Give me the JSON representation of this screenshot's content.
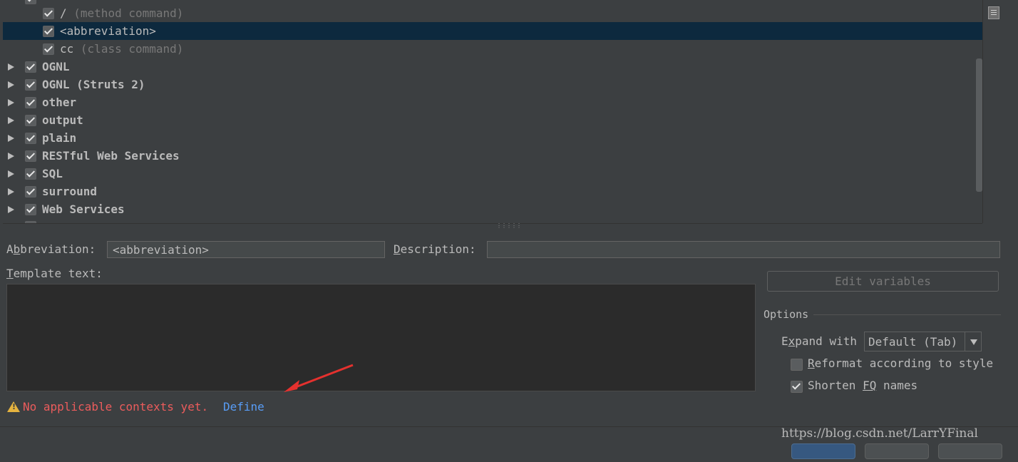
{
  "tree": {
    "rows": [
      {
        "label": "/",
        "hint": " (method command)",
        "checked": true,
        "level": 1,
        "selected": false,
        "expandable": false,
        "bold": false
      },
      {
        "label": "<abbreviation>",
        "hint": "",
        "checked": true,
        "level": 1,
        "selected": true,
        "expandable": false,
        "bold": false
      },
      {
        "label": "cc",
        "hint": " (class command)",
        "checked": true,
        "level": 1,
        "selected": false,
        "expandable": false,
        "bold": false
      },
      {
        "label": "OGNL",
        "hint": "",
        "checked": true,
        "level": 0,
        "selected": false,
        "expandable": true,
        "bold": true
      },
      {
        "label": "OGNL (Struts 2)",
        "hint": "",
        "checked": true,
        "level": 0,
        "selected": false,
        "expandable": true,
        "bold": true
      },
      {
        "label": "other",
        "hint": "",
        "checked": true,
        "level": 0,
        "selected": false,
        "expandable": true,
        "bold": true
      },
      {
        "label": "output",
        "hint": "",
        "checked": true,
        "level": 0,
        "selected": false,
        "expandable": true,
        "bold": true
      },
      {
        "label": "plain",
        "hint": "",
        "checked": true,
        "level": 0,
        "selected": false,
        "expandable": true,
        "bold": true
      },
      {
        "label": "RESTful Web Services",
        "hint": "",
        "checked": true,
        "level": 0,
        "selected": false,
        "expandable": true,
        "bold": true
      },
      {
        "label": "SQL",
        "hint": "",
        "checked": true,
        "level": 0,
        "selected": false,
        "expandable": true,
        "bold": true
      },
      {
        "label": "surround",
        "hint": "",
        "checked": true,
        "level": 0,
        "selected": false,
        "expandable": true,
        "bold": true
      },
      {
        "label": "Web Services",
        "hint": "",
        "checked": true,
        "level": 0,
        "selected": false,
        "expandable": true,
        "bold": true
      }
    ]
  },
  "form": {
    "abbreviation_label_mnemonic": "b",
    "abbreviation_label_pre": "A",
    "abbreviation_label_post": "breviation:",
    "abbreviation_value": "<abbreviation>",
    "description_label_mnemonic": "D",
    "description_label_post": "escription:",
    "description_value": "",
    "template_label_mnemonic": "T",
    "template_label_post": "emplate text:",
    "template_value": "",
    "edit_variables_label": "Edit variables"
  },
  "options": {
    "title": "Options",
    "expand_label_pre": "E",
    "expand_label_mnemonic": "x",
    "expand_label_post": "pand with",
    "expand_value": "Default (Tab)",
    "reformat_mnemonic": "R",
    "reformat_post": "eformat according to style",
    "reformat_checked": false,
    "shorten_pre": "Shorten ",
    "shorten_mnemonic": "FQ",
    "shorten_post": " names",
    "shorten_checked": true
  },
  "warning": {
    "text": "No applicable contexts yet.",
    "link": "Define"
  },
  "watermark": "https://blog.csdn.net/LarrYFinal",
  "colors": {
    "background": "#3c3f41",
    "selection": "#0d293e",
    "warning_text": "#ec5c5c",
    "link": "#589df6",
    "arrow": "#e5312e"
  }
}
